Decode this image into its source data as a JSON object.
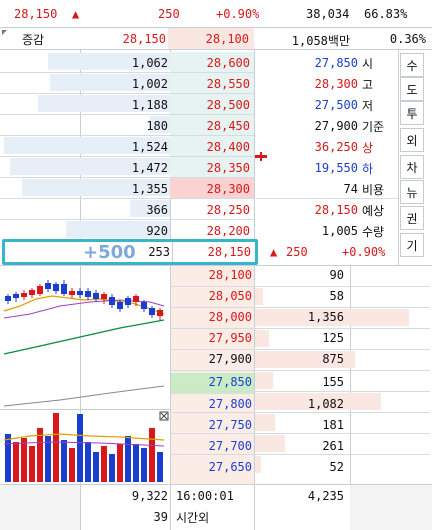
{
  "header": {
    "price": "28,150",
    "arrow": "▲",
    "change": "250",
    "change_pct": "+0.90%",
    "volume": "38,034",
    "ratio": "66.83%",
    "label_jeunggam": "증감",
    "prev_price": "28,150",
    "cur_price": "28,100",
    "amount": "1,058백만",
    "turnover": "0.36%"
  },
  "sell_rows": [
    {
      "qty": "1,062",
      "price": "28,600"
    },
    {
      "qty": "1,002",
      "price": "28,550"
    },
    {
      "qty": "1,188",
      "price": "28,500"
    },
    {
      "qty": "180",
      "price": "28,450"
    },
    {
      "qty": "1,524",
      "price": "28,400"
    },
    {
      "qty": "1,472",
      "price": "28,350"
    },
    {
      "qty": "1,355",
      "price": "28,300"
    },
    {
      "qty": "366",
      "price": "28,250"
    },
    {
      "qty": "920",
      "price": "28,200"
    },
    {
      "qty": "253",
      "price": "28,150",
      "badge": "+500"
    }
  ],
  "buy_rows": [
    {
      "price": "28,100",
      "qty": "90"
    },
    {
      "price": "28,050",
      "qty": "58"
    },
    {
      "price": "28,000",
      "qty": "1,356"
    },
    {
      "price": "27,950",
      "qty": "125"
    },
    {
      "price": "27,900",
      "qty": "875"
    },
    {
      "price": "27,850",
      "qty": "155"
    },
    {
      "price": "27,800",
      "qty": "1,082"
    },
    {
      "price": "27,750",
      "qty": "181"
    },
    {
      "price": "27,700",
      "qty": "261"
    },
    {
      "price": "27,650",
      "qty": "52"
    }
  ],
  "info": [
    {
      "value": "27,850",
      "label": "시"
    },
    {
      "value": "28,300",
      "label": "고"
    },
    {
      "value": "27,500",
      "label": "저"
    },
    {
      "value": "27,900",
      "label": "기준"
    },
    {
      "value": "36,250",
      "label": "상"
    },
    {
      "value": "19,550",
      "label": "하"
    },
    {
      "value": "74",
      "label": "비용"
    },
    {
      "value": "28,150",
      "label": "예상"
    },
    {
      "value": "1,005",
      "label": "수량"
    }
  ],
  "expected": {
    "arrow": "▲",
    "change": "250",
    "pct": "+0.90%"
  },
  "tabs": [
    "수",
    "도",
    "투",
    "외",
    "차",
    "뉴",
    "권",
    "기"
  ],
  "footer": {
    "sell_total": "9,322",
    "sell_sub": "39",
    "time": "16:00:01",
    "session": "시간외",
    "buy_total": "4,235"
  },
  "colors": {
    "up": "#d8181a",
    "down": "#1a3fcf",
    "accent": "#3ab4c8"
  }
}
